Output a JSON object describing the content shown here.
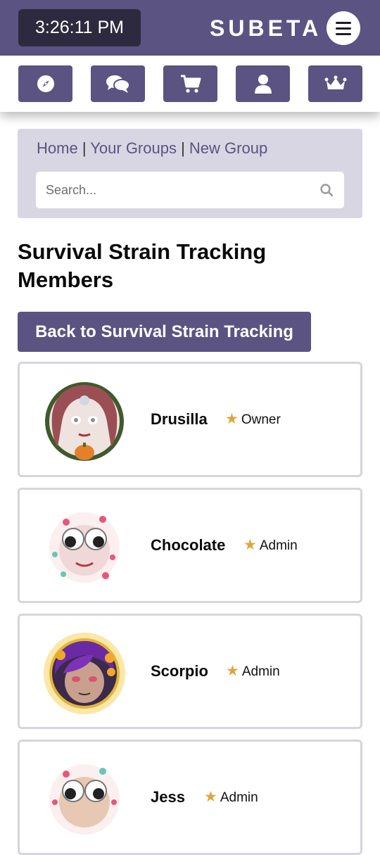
{
  "header": {
    "clock": "3:26:11 PM",
    "brand": "SUBETA",
    "menu_icon": "hamburger-icon"
  },
  "nav": {
    "buttons": [
      {
        "icon": "compass-icon"
      },
      {
        "icon": "chat-icon"
      },
      {
        "icon": "cart-icon"
      },
      {
        "icon": "user-icon"
      },
      {
        "icon": "crown-icon"
      }
    ]
  },
  "breadcrumb": {
    "items": [
      "Home",
      "Your Groups",
      "New Group"
    ],
    "separator": "|"
  },
  "search": {
    "placeholder": "Search...",
    "value": ""
  },
  "page": {
    "title": "Survival Strain Tracking Members",
    "back_button": "Back to Survival Strain Tracking"
  },
  "members": [
    {
      "name": "Drusilla",
      "role": "Owner"
    },
    {
      "name": "Chocolate",
      "role": "Admin"
    },
    {
      "name": "Scorpio",
      "role": "Admin"
    },
    {
      "name": "Jess",
      "role": "Admin"
    }
  ],
  "colors": {
    "accent": "#5b5382",
    "panel": "#d8d6e2",
    "star": "#e0a53c"
  }
}
